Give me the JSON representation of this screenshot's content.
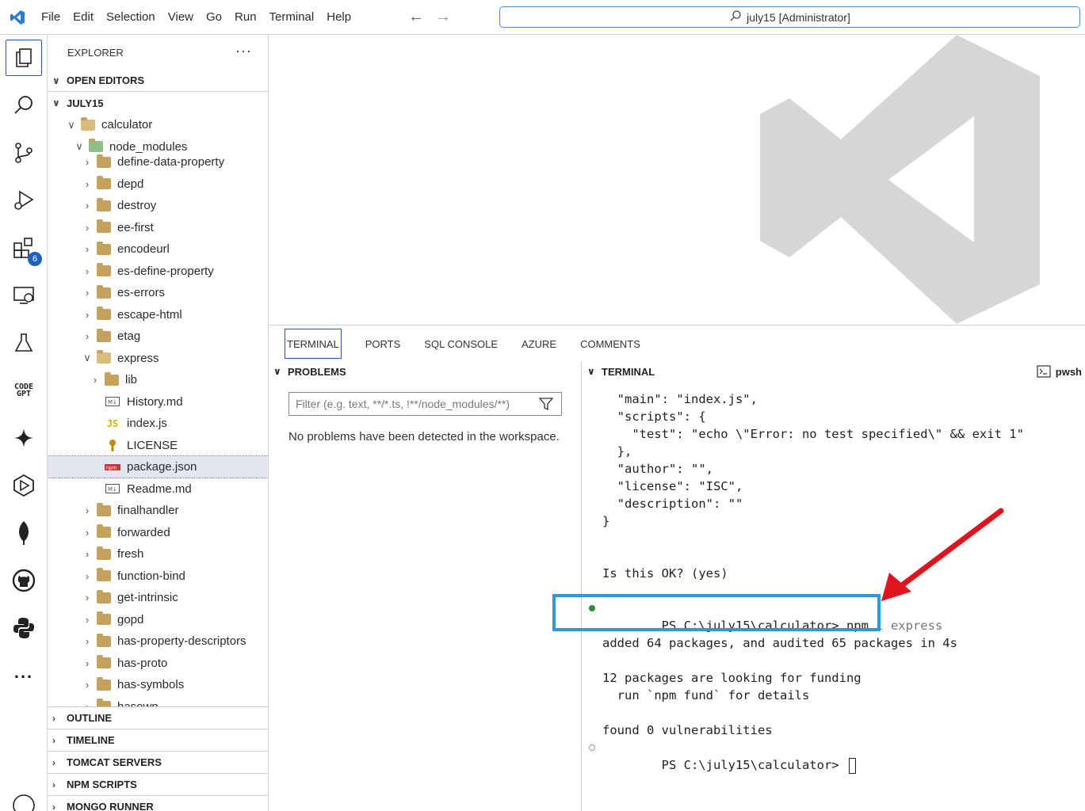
{
  "titlebar": {
    "menu": [
      "File",
      "Edit",
      "Selection",
      "View",
      "Go",
      "Run",
      "Terminal",
      "Help"
    ],
    "search_text": "july15 [Administrator]"
  },
  "activity_bar": {
    "extensions_badge": "6",
    "codegpt_label": "CODE GPT",
    "more": "..."
  },
  "sidebar": {
    "title": "EXPLORER",
    "more": "···",
    "open_editors": "OPEN EDITORS",
    "workspace": "JULY15",
    "tree": [
      {
        "label": "calculator",
        "depth": 0,
        "expanded": true
      },
      {
        "label": "node_modules",
        "depth": 1,
        "expanded": true
      },
      {
        "label": "define-data-property",
        "depth": 2,
        "expanded": false
      },
      {
        "label": "depd",
        "depth": 2,
        "expanded": false
      },
      {
        "label": "destroy",
        "depth": 2,
        "expanded": false
      },
      {
        "label": "ee-first",
        "depth": 2,
        "expanded": false
      },
      {
        "label": "encodeurl",
        "depth": 2,
        "expanded": false
      },
      {
        "label": "es-define-property",
        "depth": 2,
        "expanded": false
      },
      {
        "label": "es-errors",
        "depth": 2,
        "expanded": false
      },
      {
        "label": "escape-html",
        "depth": 2,
        "expanded": false
      },
      {
        "label": "etag",
        "depth": 2,
        "expanded": false
      },
      {
        "label": "express",
        "depth": 2,
        "expanded": true
      },
      {
        "label": "lib",
        "depth": 3,
        "expanded": false
      },
      {
        "label": "History.md",
        "depth": 3,
        "file": "md"
      },
      {
        "label": "index.js",
        "depth": 3,
        "file": "js"
      },
      {
        "label": "LICENSE",
        "depth": 3,
        "file": "license"
      },
      {
        "label": "package.json",
        "depth": 3,
        "file": "npm",
        "selected": true
      },
      {
        "label": "Readme.md",
        "depth": 3,
        "file": "md"
      },
      {
        "label": "finalhandler",
        "depth": 2,
        "expanded": false
      },
      {
        "label": "forwarded",
        "depth": 2,
        "expanded": false
      },
      {
        "label": "fresh",
        "depth": 2,
        "expanded": false
      },
      {
        "label": "function-bind",
        "depth": 2,
        "expanded": false
      },
      {
        "label": "get-intrinsic",
        "depth": 2,
        "expanded": false
      },
      {
        "label": "gopd",
        "depth": 2,
        "expanded": false
      },
      {
        "label": "has-property-descriptors",
        "depth": 2,
        "expanded": false
      },
      {
        "label": "has-proto",
        "depth": 2,
        "expanded": false
      },
      {
        "label": "has-symbols",
        "depth": 2,
        "expanded": false
      },
      {
        "label": "hasown",
        "depth": 2,
        "expanded": false
      }
    ],
    "bottom_sections": [
      "OUTLINE",
      "TIMELINE",
      "TOMCAT SERVERS",
      "NPM SCRIPTS",
      "MONGO RUNNER"
    ]
  },
  "panel": {
    "tabs": [
      "TERMINAL",
      "PORTS",
      "SQL CONSOLE",
      "AZURE",
      "COMMENTS"
    ],
    "active_tab": "TERMINAL",
    "problems_header": "PROBLEMS",
    "filter_placeholder": "Filter (e.g. text, **/*.ts, !**/node_modules/**)",
    "no_problems": "No problems have been detected in the workspace.",
    "terminal_header": "TERMINAL",
    "shell": "pwsh",
    "lines": [
      "  \"main\": \"index.js\",",
      "  \"scripts\": {",
      "    \"test\": \"echo \\\"Error: no test specified\\\" && exit 1\"",
      "  },",
      "  \"author\": \"\",",
      "  \"license\": \"ISC\",",
      "  \"description\": \"\"",
      "}",
      "",
      "",
      "Is this OK? (yes)",
      "",
      "",
      "",
      "added 64 packages, and audited 65 packages in 4s",
      "",
      "12 packages are looking for funding",
      "  run `npm fund` for details",
      "",
      "found 0 vulnerabilities"
    ],
    "command_prompt": "PS C:\\july15\\calculator> ",
    "command_cmd": "npm",
    "command_args": " i express",
    "last_prompt": "PS C:\\july15\\calculator> "
  }
}
